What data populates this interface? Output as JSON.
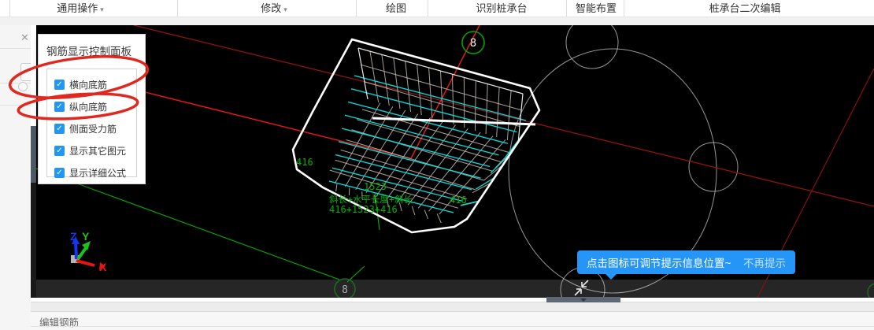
{
  "toolbar": {
    "items": [
      {
        "label": "通用操作",
        "dropdown": true
      },
      {
        "label": "修改",
        "dropdown": true
      },
      {
        "label": "绘图",
        "dropdown": false
      },
      {
        "label": "识别桩承台",
        "dropdown": false
      },
      {
        "label": "智能布置",
        "dropdown": false
      },
      {
        "label": "桩承台二次编辑",
        "dropdown": false
      }
    ]
  },
  "rebar_panel": {
    "title": "钢筋显示控制面板",
    "checkboxes": [
      {
        "label": "横向底筋",
        "checked": true
      },
      {
        "label": "纵向底筋",
        "checked": true
      },
      {
        "label": "侧面受力筋",
        "checked": true
      },
      {
        "label": "显示其它图元",
        "checked": true
      },
      {
        "label": "显示详细公式",
        "checked": true
      }
    ]
  },
  "viewport": {
    "axis_bubble_top": "8",
    "axis_bubble_bottom": "8",
    "annotations": {
      "dim_left": "416",
      "dim_middle": "1523",
      "dim_right": "416",
      "formula_line1": "斜长+水平长度+斜长",
      "formula_line2": "416+1523+416"
    },
    "triad": {
      "x": "X",
      "y": "Y",
      "z": "Z"
    }
  },
  "tooltip": {
    "text": "点击图标可调节提示信息位置~",
    "dismiss_label": "不再提示"
  },
  "bottom_panel": {
    "title": "编辑钢筋"
  },
  "icons": {
    "close": "✕",
    "dropdown": "▾",
    "check": "✓"
  },
  "colors": {
    "tooltip_blue": "#2596f7",
    "checkbox_blue": "#2196f3",
    "mesh_gray": "#c7bdb2",
    "rebar_cyan": "#00e1e1",
    "cad_green": "#00b400",
    "axis_red_bright": "#f01818",
    "axis_red_dark": "#9b1212",
    "annotation_red": "#e0281e",
    "circle_gray": "#c8c8c8"
  }
}
